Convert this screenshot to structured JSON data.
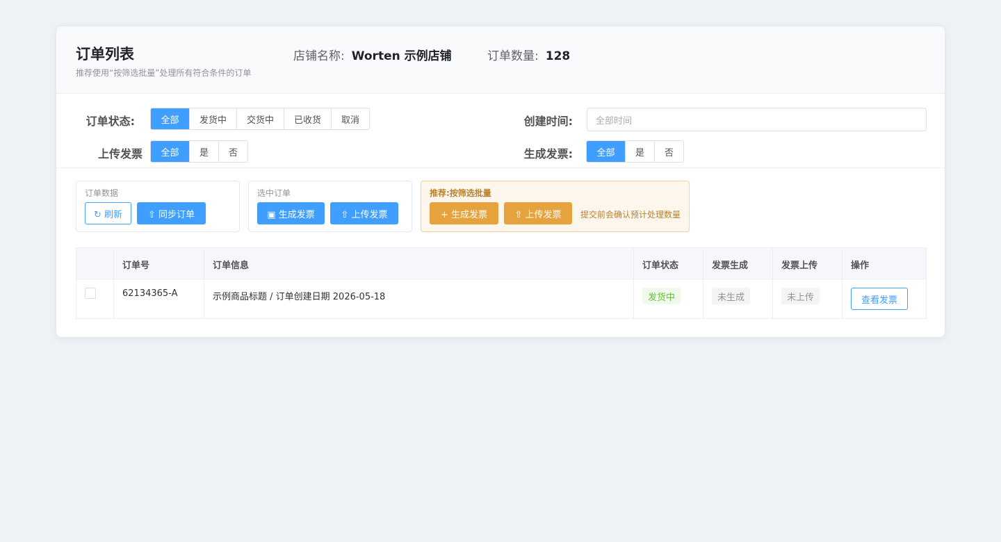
{
  "header": {
    "title": "订单列表",
    "subtitle": "推荐使用“按筛选批量”处理所有符合条件的订单",
    "store_label": "店铺名称:",
    "store_value": "Worten 示例店铺",
    "count_label": "订单数量:",
    "count_value": "128"
  },
  "filters": {
    "order_status": {
      "label": "订单状态:",
      "options": [
        "全部",
        "发货中",
        "交货中",
        "已收货",
        "取消"
      ],
      "selected": "全部"
    },
    "upload_invoice": {
      "label": "上传发票",
      "options": [
        "全部",
        "是",
        "否"
      ],
      "selected": "全部"
    },
    "created_time": {
      "label": "创建时间:",
      "placeholder": "全部时间"
    },
    "generate_invoice": {
      "label": "生成发票:",
      "options": [
        "全部",
        "是",
        "否"
      ],
      "selected": "全部"
    }
  },
  "actions": {
    "order_data": {
      "label": "订单数据",
      "refresh": "↻ 刷新",
      "sync": "⇧ 同步订单"
    },
    "selected_orders": {
      "label": "选中订单",
      "generate": "▣ 生成发票",
      "upload": "⇧ 上传发票"
    },
    "recommended": {
      "label": "推荐:按筛选批量",
      "generate": "+ 生成发票",
      "upload": "⇧ 上传发票",
      "hint": "提交前会确认预计处理数量"
    }
  },
  "table": {
    "columns": [
      "订单号",
      "订单信息",
      "订单状态",
      "发票生成",
      "发票上传",
      "操作"
    ],
    "rows": [
      {
        "order_no": "62134365-A",
        "info": "示例商品标题 / 订单创建日期 2026-05-18",
        "status": "发货中",
        "invoice_generated": "未生成",
        "invoice_uploaded": "未上传",
        "action": "查看发票"
      }
    ]
  },
  "colors": {
    "primary": "#409eff",
    "warning": "#e6a23c",
    "success": "#67c23a",
    "background": "#eef1f5"
  }
}
